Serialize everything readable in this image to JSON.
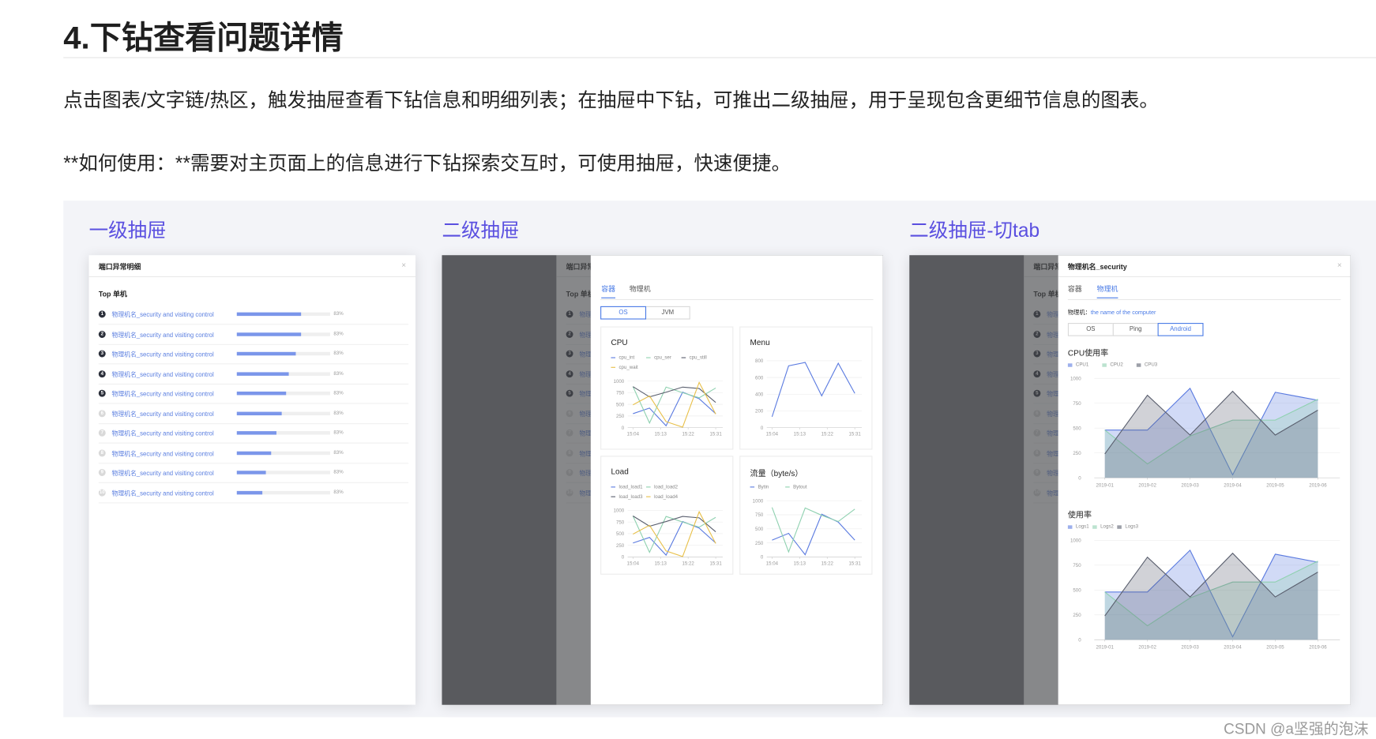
{
  "doc": {
    "title": "4.下钻查看问题详情",
    "para1": "点击图表/文字链/热区，触发抽屉查看下钻信息和明细列表；在抽屉中下钻，可推出二级抽屉，用于呈现包含更细节信息的图表。",
    "para2": "**如何使用：**需要对主页面上的信息进行下钻探索交互时，可使用抽屉，快速便捷。",
    "watermark": "CSDN @a坚强的泡沫"
  },
  "sections": [
    "一级抽屉",
    "二级抽屉",
    "二级抽屉-切tab"
  ],
  "colors": {
    "accent": "#4a7be6",
    "section_title": "#5a4fe0",
    "blue": "#5b7be0",
    "green": "#8fd1b0",
    "dark": "#5a5f6e",
    "yellow": "#e8c04a"
  },
  "drawer1": {
    "title": "端口异常明细",
    "close_icon": "×",
    "top_title": "Top 单机",
    "rows": [
      {
        "rank": "1",
        "name": "物理机名_security and visiting control",
        "percent": "83%",
        "fill": 0.69
      },
      {
        "rank": "2",
        "name": "物理机名_security and visiting control",
        "percent": "83%",
        "fill": 0.69
      },
      {
        "rank": "3",
        "name": "物理机名_security and visiting control",
        "percent": "83%",
        "fill": 0.63
      },
      {
        "rank": "4",
        "name": "物理机名_security and visiting control",
        "percent": "83%",
        "fill": 0.56
      },
      {
        "rank": "5",
        "name": "物理机名_security and visiting control",
        "percent": "83%",
        "fill": 0.53
      },
      {
        "rank": "6",
        "name": "物理机名_security and visiting control",
        "percent": "83%",
        "fill": 0.48
      },
      {
        "rank": "7",
        "name": "物理机名_security and visiting control",
        "percent": "83%",
        "fill": 0.42
      },
      {
        "rank": "8",
        "name": "物理机名_security and visiting control",
        "percent": "83%",
        "fill": 0.37
      },
      {
        "rank": "9",
        "name": "物理机名_security and visiting control",
        "percent": "83%",
        "fill": 0.31
      },
      {
        "rank": "10",
        "name": "物理机名_security and visiting control",
        "percent": "83%",
        "fill": 0.27
      }
    ]
  },
  "drawer2": {
    "tabs": [
      "容器",
      "物理机"
    ],
    "active_tab": 0,
    "segments": [
      "OS",
      "JVM"
    ],
    "active_segment": 0
  },
  "drawer3": {
    "title": "物理机名_security",
    "close_icon": "×",
    "tabs": [
      "容器",
      "物理机"
    ],
    "active_tab": 1,
    "machine_label": "物理机：",
    "machine_value": "the name of the computer",
    "segments": [
      "OS",
      "Ping",
      "Android"
    ],
    "active_segment": 2
  },
  "chart_data": [
    {
      "type": "line",
      "title": "CPU",
      "x": [
        "15:04",
        "15:09",
        "15:15",
        "15:20",
        "15:26",
        "15:31"
      ],
      "xticks": [
        "15:04",
        "15:13",
        "15:22",
        "15:31"
      ],
      "yticks": [
        "0",
        "250",
        "500",
        "750",
        "1000"
      ],
      "ylim": [
        0,
        1000
      ],
      "series": [
        {
          "name": "cpu_int",
          "color": "#5b7be0",
          "values": [
            300,
            420,
            40,
            760,
            620,
            300
          ]
        },
        {
          "name": "cpu_ser",
          "color": "#8fd1b0",
          "values": [
            880,
            100,
            870,
            750,
            640,
            850
          ]
        },
        {
          "name": "cpu_still",
          "color": "#5a5f6e",
          "values": [
            880,
            660,
            760,
            870,
            840,
            540
          ]
        },
        {
          "name": "cpu_wait",
          "color": "#e8c04a",
          "values": [
            490,
            680,
            130,
            10,
            970,
            290
          ]
        }
      ]
    },
    {
      "type": "line",
      "title": "Menu",
      "x": [
        "15:04",
        "15:09",
        "15:15",
        "15:20",
        "15:26",
        "15:31"
      ],
      "xticks": [
        "15:04",
        "15:13",
        "15:22",
        "15:31"
      ],
      "yticks": [
        "0",
        "200",
        "400",
        "600",
        "800"
      ],
      "ylim": [
        0,
        800
      ],
      "series": [
        {
          "color": "#5b7be0",
          "values": [
            130,
            740,
            780,
            380,
            770,
            410
          ]
        }
      ]
    },
    {
      "type": "line",
      "title": "Load",
      "x": [
        "15:04",
        "15:09",
        "15:15",
        "15:20",
        "15:26",
        "15:31"
      ],
      "xticks": [
        "15:04",
        "15:13",
        "15:22",
        "15:31"
      ],
      "yticks": [
        "0",
        "250",
        "500",
        "750",
        "1000"
      ],
      "ylim": [
        0,
        1000
      ],
      "series": [
        {
          "name": "load_load1",
          "color": "#5b7be0",
          "values": [
            300,
            420,
            40,
            760,
            620,
            300
          ]
        },
        {
          "name": "load_load2",
          "color": "#8fd1b0",
          "values": [
            880,
            100,
            870,
            750,
            640,
            850
          ]
        },
        {
          "name": "load_load3",
          "color": "#5a5f6e",
          "values": [
            880,
            660,
            760,
            870,
            840,
            540
          ]
        },
        {
          "name": "load_load4",
          "color": "#e8c04a",
          "values": [
            490,
            680,
            130,
            10,
            970,
            290
          ]
        }
      ]
    },
    {
      "type": "line",
      "title": "流量（byte/s）",
      "x": [
        "15:04",
        "15:09",
        "15:15",
        "15:20",
        "15:26",
        "15:31"
      ],
      "xticks": [
        "15:04",
        "15:13",
        "15:22",
        "15:31"
      ],
      "yticks": [
        "0",
        "250",
        "500",
        "750",
        "1000"
      ],
      "ylim": [
        0,
        1000
      ],
      "series": [
        {
          "name": "Bytin",
          "color": "#5b7be0",
          "values": [
            300,
            420,
            40,
            760,
            620,
            300
          ]
        },
        {
          "name": "Bytout",
          "color": "#8fd1b0",
          "values": [
            880,
            90,
            870,
            740,
            630,
            850
          ]
        }
      ]
    },
    {
      "type": "area",
      "title": "CPU使用率",
      "x": [
        "2019-01",
        "2019-02",
        "2019-03",
        "2019-04",
        "2019-05",
        "2019-06"
      ],
      "yticks": [
        "0",
        "250",
        "500",
        "750",
        "1000"
      ],
      "ylim": [
        0,
        1000
      ],
      "series": [
        {
          "name": "CPU1",
          "color": "#5b7be0",
          "values": [
            480,
            480,
            900,
            30,
            860,
            780
          ]
        },
        {
          "name": "CPU2",
          "color": "#8fd1b0",
          "values": [
            480,
            140,
            420,
            580,
            580,
            790
          ]
        },
        {
          "name": "CPU3",
          "color": "#5a5f6e",
          "values": [
            240,
            830,
            430,
            870,
            430,
            680
          ]
        }
      ]
    },
    {
      "type": "area",
      "title": "使用率",
      "x": [
        "2019-01",
        "2019-02",
        "2019-03",
        "2019-04",
        "2019-05",
        "2019-06"
      ],
      "yticks": [
        "0",
        "250",
        "500",
        "750",
        "1000"
      ],
      "ylim": [
        0,
        1000
      ],
      "series": [
        {
          "name": "Logs1",
          "color": "#5b7be0",
          "values": [
            480,
            480,
            900,
            30,
            860,
            780
          ]
        },
        {
          "name": "Logs2",
          "color": "#8fd1b0",
          "values": [
            480,
            140,
            420,
            580,
            580,
            790
          ]
        },
        {
          "name": "Logs3",
          "color": "#5a5f6e",
          "values": [
            240,
            830,
            430,
            870,
            430,
            680
          ]
        }
      ]
    }
  ]
}
